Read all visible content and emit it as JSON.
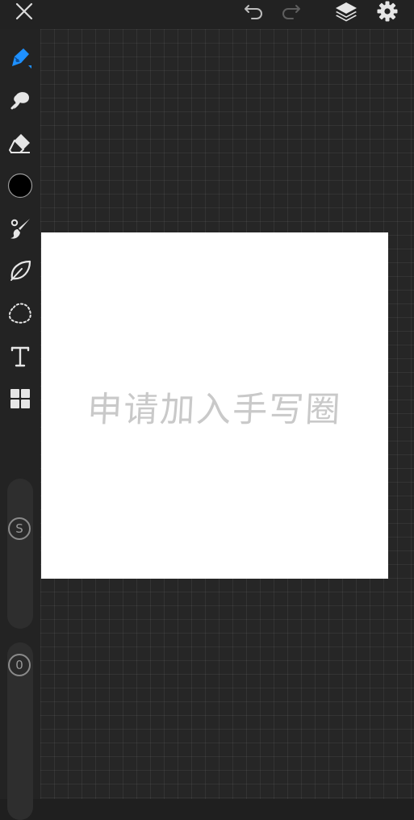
{
  "toolbar": {
    "icons": [
      "close-icon",
      "undo-icon",
      "redo-icon",
      "layers-icon",
      "settings-icon"
    ]
  },
  "tools": [
    "pen-icon",
    "smudge-icon",
    "eraser-icon",
    "color-swatch",
    "brush-icon",
    "leaf-icon",
    "lasso-icon",
    "text-icon",
    "grid-blocks-icon"
  ],
  "active_color": "#000000",
  "accent_color": "#1e90ff",
  "size_slider": {
    "label": "S"
  },
  "opacity_slider": {
    "label": "0"
  },
  "canvas": {
    "text": "申请加入手写圈",
    "background": "#ffffff"
  }
}
